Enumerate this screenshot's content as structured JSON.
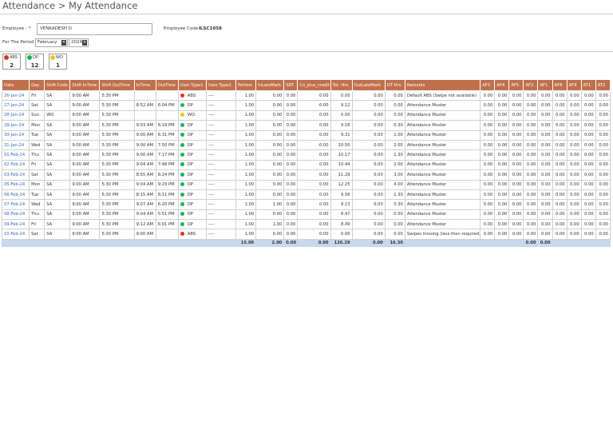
{
  "header": {
    "title": "Attendance > My Attendance"
  },
  "form": {
    "employee_label": "Employee : ",
    "employee_required": "*",
    "employee_value": "VENKADESH D",
    "employee_code_label": "Employee Code : ",
    "employee_code_value": "ILSC1058",
    "period_label": "For The Period",
    "month_value": "February",
    "year_value": "2024"
  },
  "legend": [
    {
      "code": "ABS",
      "count": "2",
      "color": "#e0301e"
    },
    {
      "code": "DP",
      "count": "12",
      "color": "#12b84f"
    },
    {
      "code": "WO",
      "count": "1",
      "color": "#f2c318"
    }
  ],
  "table": {
    "columns": [
      "Date",
      "Day",
      "Shift Code",
      "Shift InTime",
      "Shift OutTime",
      "InTime",
      "OutTime",
      "User Type1",
      "User Type2",
      "Portion",
      "InLateMark",
      "SRT",
      "Co_plus_credit",
      "Tot. Hrs.",
      "OutLateMark",
      "OT Hrs.",
      "Remarks",
      "AF3",
      "AF4",
      "AF5",
      "AF2",
      "AF1",
      "AF8",
      "AF9",
      "AT1",
      "AT2"
    ],
    "rows": [
      {
        "date": "26-Jan-24",
        "day": "Fri",
        "shift": "SA",
        "sin": "9:00 AM",
        "sout": "5:30 PM",
        "in": "",
        "out": "",
        "ut1": "ABS",
        "ut1color": "#e0301e",
        "ut2": "----",
        "portion": "1.00",
        "inlate": "0.00",
        "srt": "0.00",
        "coplus": "0.00",
        "tot": "0.00",
        "outlate": "0.00",
        "ot": "0.00",
        "remarks": "Default ABS (Swipe not available)",
        "af3": "0.00",
        "af4": "0.00",
        "af5": "0.00",
        "af2": "0.00",
        "af1": "0.00",
        "af8": "0.00",
        "af9": "0.00",
        "at1": "0.00",
        "at2": "0.00"
      },
      {
        "date": "27-Jan-24",
        "day": "Sat",
        "shift": "SA",
        "sin": "9:00 AM",
        "sout": "5:30 PM",
        "in": "8:52 AM",
        "out": "6:04 PM",
        "ut1": "DP",
        "ut1color": "#12b84f",
        "ut2": "----",
        "portion": "1.00",
        "inlate": "0.00",
        "srt": "0.00",
        "coplus": "0.00",
        "tot": "9.12",
        "outlate": "0.00",
        "ot": "0.00",
        "remarks": "Attendance Muster",
        "af3": "0.00",
        "af4": "0.00",
        "af5": "0.00",
        "af2": "0.00",
        "af1": "0.00",
        "af8": "0.00",
        "af9": "0.00",
        "at1": "0.00",
        "at2": "0.00"
      },
      {
        "date": "28-Jan-24",
        "day": "Sun",
        "shift": "WO",
        "sin": "9:00 AM",
        "sout": "5:30 PM",
        "in": "",
        "out": "",
        "ut1": "WO",
        "ut1color": "#f2c318",
        "ut2": "----",
        "portion": "1.00",
        "inlate": "0.00",
        "srt": "0.00",
        "coplus": "0.00",
        "tot": "0.00",
        "outlate": "0.00",
        "ot": "0.00",
        "remarks": "Attendance Muster",
        "af3": "0.00",
        "af4": "0.00",
        "af5": "0.00",
        "af2": "0.00",
        "af1": "0.00",
        "af8": "0.00",
        "af9": "0.00",
        "at1": "0.00",
        "at2": "0.00"
      },
      {
        "date": "29-Jan-24",
        "day": "Mon",
        "shift": "SA",
        "sin": "9:00 AM",
        "sout": "5:30 PM",
        "in": "9:03 AM",
        "out": "6:19 PM",
        "ut1": "DP",
        "ut1color": "#12b84f",
        "ut2": "----",
        "portion": "1.00",
        "inlate": "0.00",
        "srt": "0.00",
        "coplus": "0.00",
        "tot": "9.16",
        "outlate": "0.00",
        "ot": "0.30",
        "remarks": "Attendance Muster",
        "af3": "0.00",
        "af4": "0.00",
        "af5": "0.00",
        "af2": "0.00",
        "af1": "0.00",
        "af8": "0.00",
        "af9": "0.00",
        "at1": "0.00",
        "at2": "0.00"
      },
      {
        "date": "30-Jan-24",
        "day": "Tue",
        "shift": "SA",
        "sin": "9:00 AM",
        "sout": "5:30 PM",
        "in": "9:00 AM",
        "out": "6:31 PM",
        "ut1": "DP",
        "ut1color": "#12b84f",
        "ut2": "----",
        "portion": "1.00",
        "inlate": "0.00",
        "srt": "0.00",
        "coplus": "0.00",
        "tot": "9.31",
        "outlate": "0.00",
        "ot": "1.00",
        "remarks": "Attendance Muster",
        "af3": "0.00",
        "af4": "0.00",
        "af5": "0.00",
        "af2": "0.00",
        "af1": "0.00",
        "af8": "0.00",
        "af9": "0.00",
        "at1": "0.00",
        "at2": "0.00"
      },
      {
        "date": "31-Jan-24",
        "day": "Wed",
        "shift": "SA",
        "sin": "9:00 AM",
        "sout": "5:30 PM",
        "in": "9:00 AM",
        "out": "7:50 PM",
        "ut1": "DP",
        "ut1color": "#12b84f",
        "ut2": "----",
        "portion": "1.00",
        "inlate": "0.00",
        "srt": "0.00",
        "coplus": "0.00",
        "tot": "10.50",
        "outlate": "0.00",
        "ot": "2.00",
        "remarks": "Attendance Muster",
        "af3": "0.00",
        "af4": "0.00",
        "af5": "0.00",
        "af2": "0.00",
        "af1": "0.00",
        "af8": "0.00",
        "af9": "0.00",
        "at1": "0.00",
        "at2": "0.00"
      },
      {
        "date": "01-Feb-24",
        "day": "Thu",
        "shift": "SA",
        "sin": "9:00 AM",
        "sout": "5:30 PM",
        "in": "9:00 AM",
        "out": "7:17 PM",
        "ut1": "DP",
        "ut1color": "#12b84f",
        "ut2": "----",
        "portion": "1.00",
        "inlate": "0.00",
        "srt": "0.00",
        "coplus": "0.00",
        "tot": "10.17",
        "outlate": "0.00",
        "ot": "1.30",
        "remarks": "Attendance Muster",
        "af3": "0.00",
        "af4": "0.00",
        "af5": "0.00",
        "af2": "0.00",
        "af1": "0.00",
        "af8": "0.00",
        "af9": "0.00",
        "at1": "0.00",
        "at2": "0.00"
      },
      {
        "date": "02-Feb-24",
        "day": "Fri",
        "shift": "SA",
        "sin": "9:00 AM",
        "sout": "5:30 PM",
        "in": "9:04 AM",
        "out": "7:48 PM",
        "ut1": "DP",
        "ut1color": "#12b84f",
        "ut2": "----",
        "portion": "1.00",
        "inlate": "0.00",
        "srt": "0.00",
        "coplus": "0.00",
        "tot": "10.44",
        "outlate": "0.00",
        "ot": "2.00",
        "remarks": "Attendance Muster",
        "af3": "0.00",
        "af4": "0.00",
        "af5": "0.00",
        "af2": "0.00",
        "af1": "0.00",
        "af8": "0.00",
        "af9": "0.00",
        "at1": "0.00",
        "at2": "0.00"
      },
      {
        "date": "03-Feb-24",
        "day": "Sat",
        "shift": "SA",
        "sin": "9:00 AM",
        "sout": "5:30 PM",
        "in": "8:55 AM",
        "out": "8:24 PM",
        "ut1": "DP",
        "ut1color": "#12b84f",
        "ut2": "----",
        "portion": "1.00",
        "inlate": "0.00",
        "srt": "0.00",
        "coplus": "0.00",
        "tot": "11.29",
        "outlate": "0.00",
        "ot": "3.00",
        "remarks": "Attendance Muster",
        "af3": "0.00",
        "af4": "0.00",
        "af5": "0.00",
        "af2": "0.00",
        "af1": "0.00",
        "af8": "0.00",
        "af9": "0.00",
        "at1": "0.00",
        "at2": "0.00"
      },
      {
        "date": "05-Feb-24",
        "day": "Mon",
        "shift": "SA",
        "sin": "9:00 AM",
        "sout": "5:30 PM",
        "in": "9:04 AM",
        "out": "9:29 PM",
        "ut1": "DP",
        "ut1color": "#12b84f",
        "ut2": "----",
        "portion": "1.00",
        "inlate": "0.00",
        "srt": "0.00",
        "coplus": "0.00",
        "tot": "12.25",
        "outlate": "0.00",
        "ot": "4.00",
        "remarks": "Attendance Muster",
        "af3": "0.00",
        "af4": "0.00",
        "af5": "0.00",
        "af2": "0.00",
        "af1": "0.00",
        "af8": "0.00",
        "af9": "0.00",
        "at1": "0.00",
        "at2": "0.00"
      },
      {
        "date": "06-Feb-24",
        "day": "Tue",
        "shift": "SA",
        "sin": "9:00 AM",
        "sout": "5:30 PM",
        "in": "8:15 AM",
        "out": "6:11 PM",
        "ut1": "DP",
        "ut1color": "#12b84f",
        "ut2": "----",
        "portion": "1.00",
        "inlate": "0.00",
        "srt": "0.00",
        "coplus": "0.00",
        "tot": "9.56",
        "outlate": "0.00",
        "ot": "1.30",
        "remarks": "Attendance Muster",
        "af3": "0.00",
        "af4": "0.00",
        "af5": "0.00",
        "af2": "0.00",
        "af1": "0.00",
        "af8": "0.00",
        "af9": "0.00",
        "at1": "0.00",
        "at2": "0.00"
      },
      {
        "date": "07-Feb-24",
        "day": "Wed",
        "shift": "SA",
        "sin": "9:00 AM",
        "sout": "5:30 PM",
        "in": "9:07 AM",
        "out": "6:20 PM",
        "ut1": "DP",
        "ut1color": "#12b84f",
        "ut2": "----",
        "portion": "1.00",
        "inlate": "1.00",
        "srt": "0.00",
        "coplus": "0.00",
        "tot": "9.13",
        "outlate": "0.00",
        "ot": "0.30",
        "remarks": "Attendance Muster",
        "af3": "0.00",
        "af4": "0.00",
        "af5": "0.00",
        "af2": "0.00",
        "af1": "0.00",
        "af8": "0.00",
        "af9": "0.00",
        "at1": "0.00",
        "at2": "0.00"
      },
      {
        "date": "08-Feb-24",
        "day": "Thu",
        "shift": "SA",
        "sin": "9:00 AM",
        "sout": "5:30 PM",
        "in": "9:04 AM",
        "out": "5:51 PM",
        "ut1": "DP",
        "ut1color": "#12b84f",
        "ut2": "----",
        "portion": "1.00",
        "inlate": "0.00",
        "srt": "0.00",
        "coplus": "0.00",
        "tot": "8.47",
        "outlate": "0.00",
        "ot": "0.00",
        "remarks": "Attendance Muster",
        "af3": "0.00",
        "af4": "0.00",
        "af5": "0.00",
        "af2": "0.00",
        "af1": "0.00",
        "af8": "0.00",
        "af9": "0.00",
        "at1": "0.00",
        "at2": "0.00"
      },
      {
        "date": "09-Feb-24",
        "day": "Fri",
        "shift": "SA",
        "sin": "9:00 AM",
        "sout": "5:30 PM",
        "in": "9:12 AM",
        "out": "6:01 PM",
        "ut1": "DP",
        "ut1color": "#12b84f",
        "ut2": "----",
        "portion": "1.00",
        "inlate": "1.00",
        "srt": "0.00",
        "coplus": "0.00",
        "tot": "8.49",
        "outlate": "0.00",
        "ot": "0.00",
        "remarks": "Attendance Muster",
        "af3": "0.00",
        "af4": "0.00",
        "af5": "0.00",
        "af2": "0.00",
        "af1": "0.00",
        "af8": "0.00",
        "af9": "0.00",
        "at1": "0.00",
        "at2": "0.00"
      },
      {
        "date": "10-Feb-24",
        "day": "Sat",
        "shift": "SA",
        "sin": "9:00 AM",
        "sout": "5:30 PM",
        "in": "9:00 AM",
        "out": "",
        "ut1": "ABS",
        "ut1color": "#e0301e",
        "ut2": "----",
        "portion": "1.00",
        "inlate": "0.00",
        "srt": "0.00",
        "coplus": "0.00",
        "tot": "0.00",
        "outlate": "0.00",
        "ot": "0.00",
        "remarks": "Swipes missing (less then required)",
        "af3": "0.00",
        "af4": "0.00",
        "af5": "0.00",
        "af2": "0.00",
        "af1": "0.00",
        "af8": "0.00",
        "af9": "0.00",
        "at1": "0.00",
        "at2": "0.00"
      }
    ],
    "totals": {
      "portion": "15.00",
      "inlate": "2.00",
      "srt": "0.00",
      "coplus": "0.00",
      "tot": "126.29",
      "outlate": "0.00",
      "ot": "16.30",
      "af2": "0.00",
      "af1": "0.00"
    }
  }
}
